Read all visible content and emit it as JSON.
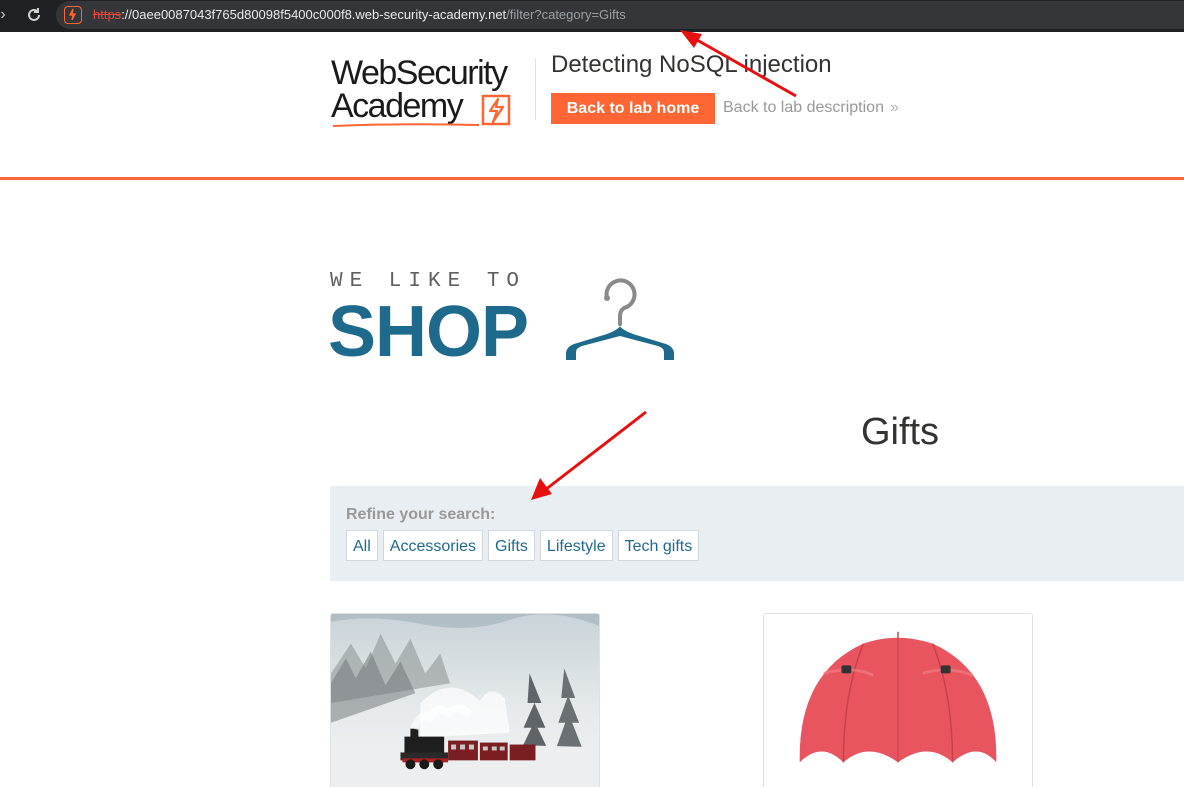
{
  "browser": {
    "url_scheme": "https",
    "url_host": "://0aee0087043f765d80098f5400c000f8.web-security-academy.net",
    "url_path": "/filter?category=Gifts",
    "forward_icon": "chevron-right-icon",
    "reload_icon": "reload-icon",
    "site_icon": "lightning-icon"
  },
  "header": {
    "logo_line1": "WebSecurity",
    "logo_line2": "Academy",
    "lab_title": "Detecting NoSQL injection",
    "back_home_label": "Back to lab home",
    "back_description_label": "Back to lab description",
    "accent_color": "#ff6633"
  },
  "shop": {
    "tagline": "WE LIKE TO",
    "word": "SHOP",
    "brand_color": "#1e6a8d"
  },
  "page": {
    "category_heading": "Gifts"
  },
  "filter": {
    "label": "Refine your search:",
    "tags": [
      "All",
      "Accessories",
      "Gifts",
      "Lifestyle",
      "Tech gifts"
    ]
  },
  "products": [
    {
      "image": "steam-train-in-snowy-forest"
    },
    {
      "image": "red-double-umbrella"
    }
  ],
  "annotation_color": "#e8100f"
}
